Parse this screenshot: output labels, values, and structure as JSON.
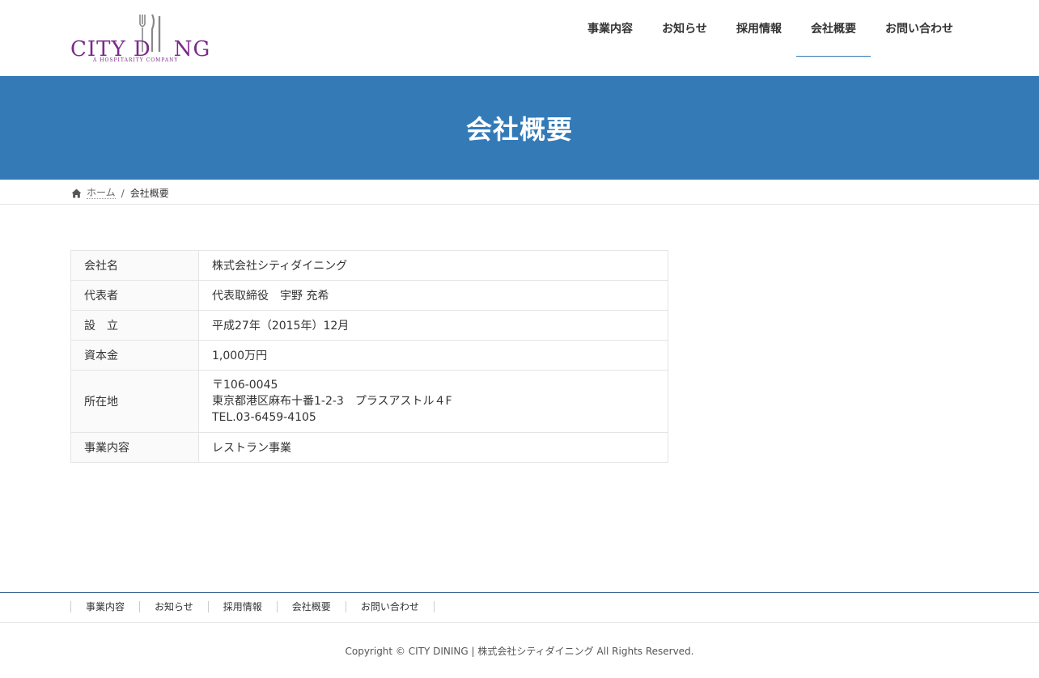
{
  "brand": {
    "logo_text_left": "CITY D",
    "logo_text_right": "NG",
    "logo_sub": "A HOSPITARITY COMPANY",
    "accent": "#7b2a8c"
  },
  "nav": {
    "items": [
      {
        "label": "事業内容"
      },
      {
        "label": "お知らせ"
      },
      {
        "label": "採用情報"
      },
      {
        "label": "会社概要"
      },
      {
        "label": "お問い合わせ"
      }
    ],
    "active_index": 3
  },
  "page": {
    "title": "会社概要",
    "header_color": "#337ab7"
  },
  "breadcrumb": {
    "home_icon": "home-icon",
    "home": "ホーム",
    "separator": "/",
    "current": "会社概要"
  },
  "company_info": {
    "rows": [
      {
        "label": "会社名",
        "value": "株式会社シティダイニング"
      },
      {
        "label": "代表者",
        "value": "代表取締役　宇野 充希"
      },
      {
        "label": "設　立",
        "value": "平成27年（2015年）12月"
      },
      {
        "label": "資本金",
        "value": "1,000万円"
      },
      {
        "label": "所在地",
        "lines": [
          "〒106-0045",
          "東京都港区麻布十番1-2-3　プラスアストル４F",
          "TEL.03-6459-4105"
        ]
      },
      {
        "label": "事業内容",
        "value": "レストラン事業"
      }
    ]
  },
  "footer": {
    "nav": [
      "事業内容",
      "お知らせ",
      "採用情報",
      "会社概要",
      "お問い合わせ"
    ],
    "copyright": "Copyright © CITY DINING | 株式会社シティダイニング All Rights Reserved."
  }
}
